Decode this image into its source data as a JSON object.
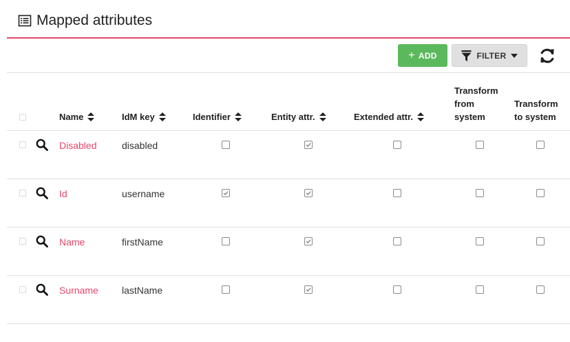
{
  "panel": {
    "title": "Mapped attributes",
    "title_icon": "list-alt-icon",
    "accent_color": "#e8466b"
  },
  "toolbar": {
    "add_label": "ADD",
    "add_color": "#5cb85c",
    "filter_label": "FILTER",
    "refresh_icon": "refresh-icon"
  },
  "table": {
    "columns": [
      {
        "key": "name",
        "label": "Name",
        "sortable": true
      },
      {
        "key": "idm_key",
        "label": "IdM key",
        "sortable": true
      },
      {
        "key": "identifier",
        "label": "Identifier",
        "sortable": true
      },
      {
        "key": "entity_attr",
        "label": "Entity attr.",
        "sortable": true
      },
      {
        "key": "extended_attr",
        "label": "Extended attr.",
        "sortable": true
      },
      {
        "key": "transform_from",
        "label": "Transform from system",
        "label_lines": [
          "Transform",
          "from",
          "system"
        ],
        "sortable": false
      },
      {
        "key": "transform_to",
        "label": "Transform to system",
        "label_lines": [
          "Transform",
          "to system"
        ],
        "sortable": false
      }
    ],
    "rows": [
      {
        "name": "Disabled",
        "idm_key": "disabled",
        "identifier": false,
        "entity_attr": true,
        "extended_attr": false,
        "transform_from": false,
        "transform_to": false
      },
      {
        "name": "Id",
        "idm_key": "username",
        "identifier": true,
        "entity_attr": true,
        "extended_attr": false,
        "transform_from": false,
        "transform_to": false
      },
      {
        "name": "Name",
        "idm_key": "firstName",
        "identifier": false,
        "entity_attr": true,
        "extended_attr": false,
        "transform_from": false,
        "transform_to": false
      },
      {
        "name": "Surname",
        "idm_key": "lastName",
        "identifier": false,
        "entity_attr": true,
        "extended_attr": false,
        "transform_from": false,
        "transform_to": false
      }
    ]
  }
}
